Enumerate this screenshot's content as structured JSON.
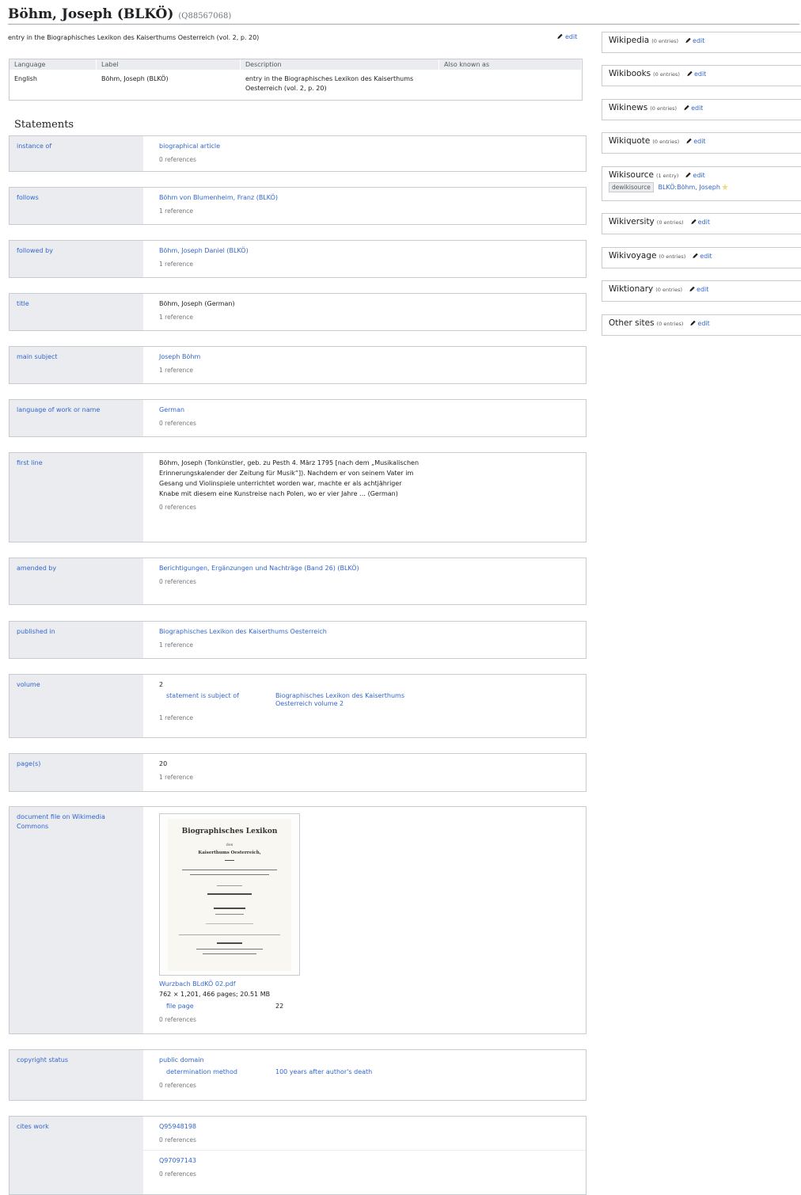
{
  "header": {
    "title": "Böhm, Joseph (BLKÖ)",
    "qid": "(Q88567068)"
  },
  "description": "entry in the Biographisches Lexikon des Kaiserthums Oesterreich (vol. 2, p. 20)",
  "edit_label": "edit",
  "lang_table": {
    "headers": [
      "Language",
      "Label",
      "Description",
      "Also known as"
    ],
    "row": {
      "language": "English",
      "label": "Böhm, Joseph (BLKÖ)",
      "description": "entry in the Biographisches Lexikon des Kaiserthums Oesterreich (vol. 2, p. 20)",
      "aliases": ""
    }
  },
  "statements_heading": "Statements",
  "statements": [
    {
      "property": "instance of",
      "value": "biographical article",
      "refs": "0 references"
    },
    {
      "property": "follows",
      "value": "Böhm von Blumenheim, Franz (BLKÖ)",
      "refs": "1 reference"
    },
    {
      "property": "followed by",
      "value": "Böhm, Joseph Daniel (BLKÖ)",
      "refs": "1 reference"
    },
    {
      "property": "title",
      "value": "Böhm, Joseph (German)",
      "refs": "1 reference"
    },
    {
      "property": "main subject",
      "value": "Joseph Böhm",
      "refs": "1 reference"
    },
    {
      "property": "language of work or name",
      "value": "German",
      "refs": "0 references"
    },
    {
      "property": "first line",
      "value": "Böhm, Joseph (Tonkünstler, geb. zu Pesth 4. März 1795 [nach dem „Musikalischen Erinnerungskalender der Zeitung für Musik“]). Nachdem er von seinem Vater im Gesang und Violinspiele unterrichtet worden war, machte er als achtjähriger Knabe mit diesem eine Kunstreise nach Polen, wo er vier Jahre … (German)",
      "refs": "0 references"
    },
    {
      "property": "amended by",
      "value": "Berichtigungen, Ergänzungen und Nachträge (Band 26) (BLKÖ)",
      "refs": "0 references"
    },
    {
      "property": "published in",
      "value": "Biographisches Lexikon des Kaiserthums Oesterreich",
      "refs": "1 reference"
    },
    {
      "property": "volume",
      "value": "2",
      "qualifier_property": "statement is subject of",
      "qualifier_value": "Biographisches Lexikon des Kaiserthums Oesterreich volume 2",
      "refs": "1 reference"
    },
    {
      "property": "page(s)",
      "value": "20",
      "refs": "1 reference"
    },
    {
      "property": "document file on Wikimedia Commons",
      "file_name": "Wurzbach BLdKÖ 02.pdf",
      "file_info": "762 × 1,201, 466 pages; 20.51 MB",
      "qualifier_property": "file page",
      "qualifier_value": "22",
      "refs": "0 references"
    },
    {
      "property": "copyright status",
      "value": "public domain",
      "qualifier_property": "determination method",
      "qualifier_value": "100 years after author's death",
      "refs": "0 references"
    },
    {
      "property": "cites work",
      "value": "Q95948198",
      "refs": "0 references",
      "value2": "Q97097143",
      "refs2": "0 references"
    }
  ],
  "sitelinks": [
    {
      "name": "Wikipedia",
      "count": "(0 entries)"
    },
    {
      "name": "Wikibooks",
      "count": "(0 entries)"
    },
    {
      "name": "Wikinews",
      "count": "(0 entries)"
    },
    {
      "name": "Wikiquote",
      "count": "(0 entries)"
    },
    {
      "name": "Wikisource",
      "count": "(1 entry)",
      "site": "dewikisource",
      "page": "BLKÖ:Böhm, Joseph"
    },
    {
      "name": "Wikiversity",
      "count": "(0 entries)"
    },
    {
      "name": "Wikivoyage",
      "count": "(0 entries)"
    },
    {
      "name": "Wiktionary",
      "count": "(0 entries)"
    },
    {
      "name": "Other sites",
      "count": "(0 entries)"
    }
  ],
  "thumbnail_text": {
    "heading": "Biographisches Lexikon",
    "line2": "des",
    "line3": "Kaiserthums Oesterreich,"
  }
}
